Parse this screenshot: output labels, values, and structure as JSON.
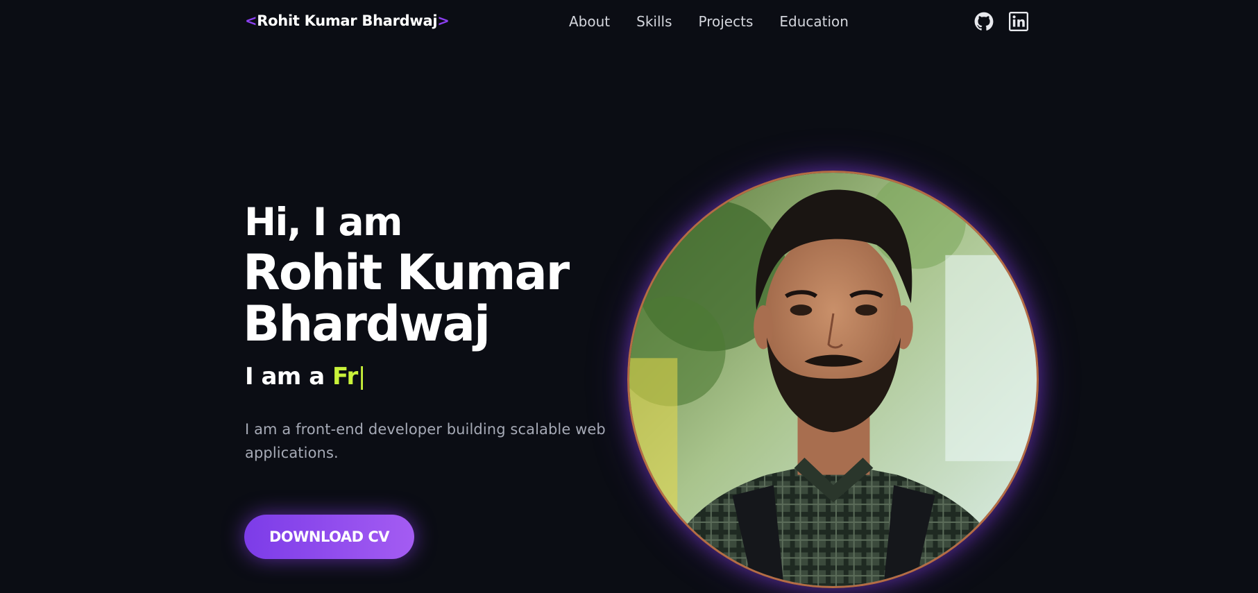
{
  "nav": {
    "logo_open": "<",
    "logo_name": "Rohit Kumar Bhardwaj",
    "logo_close": ">",
    "links": [
      {
        "label": "About"
      },
      {
        "label": "Skills"
      },
      {
        "label": "Projects"
      },
      {
        "label": "Education"
      }
    ],
    "social": [
      {
        "icon": "github-icon"
      },
      {
        "icon": "linkedin-icon"
      }
    ]
  },
  "hero": {
    "greeting": "Hi, I am",
    "name": "Rohit Kumar Bhardwaj",
    "typed_prefix": "I am a ",
    "typed_text": "Fr",
    "cursor": "|",
    "description": "I am a front-end developer building scalable web applications.",
    "cta_label": "DOWNLOAD CV"
  },
  "colors": {
    "background": "#0b0d14",
    "accent": "#8b3ff0",
    "highlight": "#c9f23a",
    "portrait_ring": "#b56c45"
  }
}
